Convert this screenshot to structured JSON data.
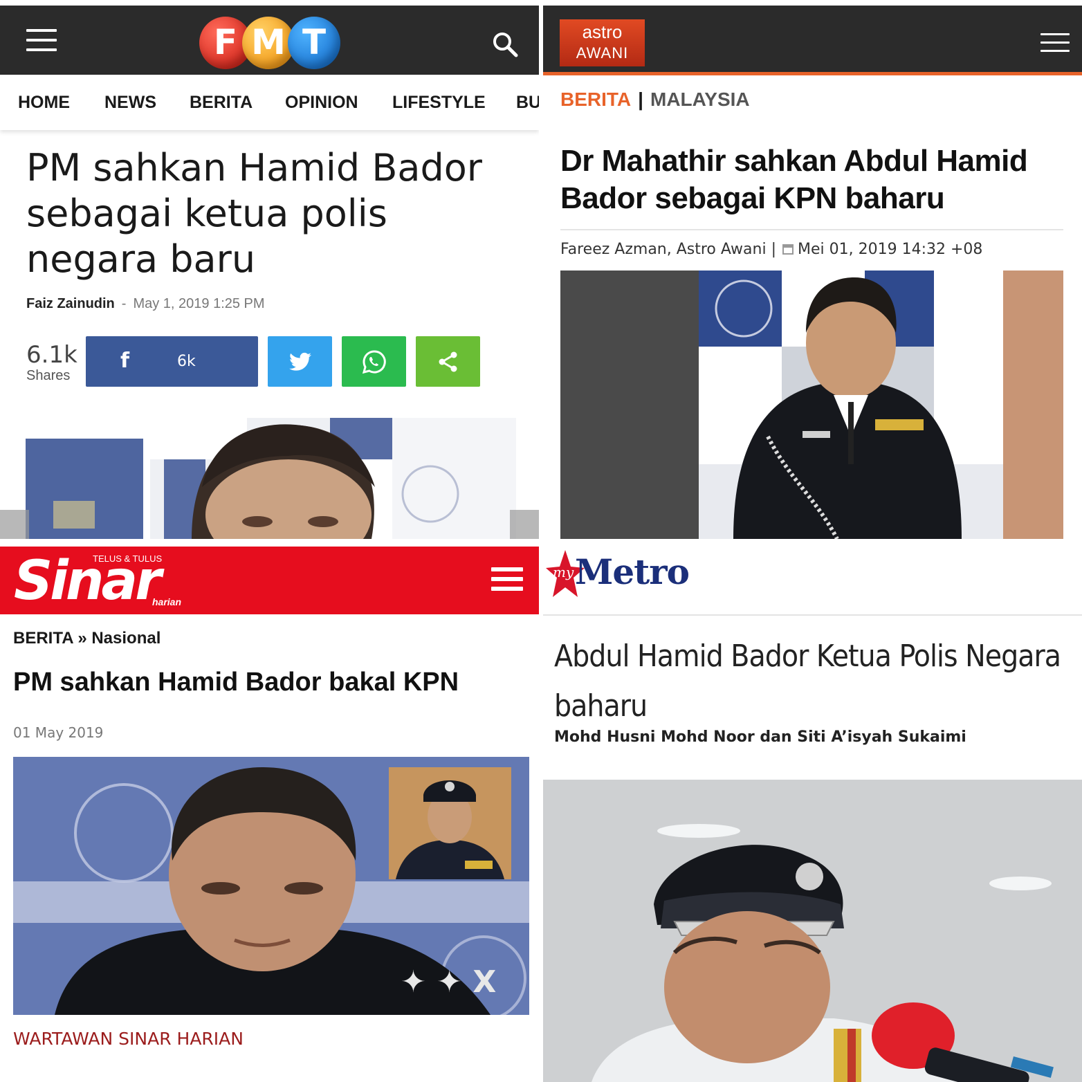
{
  "fmt": {
    "logo_letters": [
      "F",
      "M",
      "T"
    ],
    "nav": [
      "HOME",
      "NEWS",
      "BERITA",
      "OPINION",
      "LIFESTYLE",
      "BU"
    ],
    "title": "PM sahkan Hamid Bador sebagai ketua polis negara baru",
    "author": "Faiz Zainudin",
    "byline_sep": "-",
    "date": "May 1, 2019 1:25 PM",
    "shares_count": "6.1k",
    "shares_label": "Shares",
    "facebook_count": "6k",
    "colors": {
      "header": "#2b2b2b",
      "facebook": "#3b5998",
      "twitter": "#34a3ed",
      "whatsapp": "#2bbb4f",
      "share": "#6abe35"
    },
    "icons": [
      "menu-icon",
      "search-icon",
      "facebook-icon",
      "twitter-icon",
      "whatsapp-icon",
      "share-icon"
    ]
  },
  "awani": {
    "logo_line1": "astro",
    "logo_line2": "AWANI",
    "crumb_section": "BERITA",
    "crumb_sep": "|",
    "crumb_sub": "MALAYSIA",
    "title": "Dr Mahathir sahkan Abdul Hamid Bador sebagai KPN baharu",
    "byline_author": "Fareez Azman, Astro Awani |",
    "byline_date": "Mei 01, 2019 14:32 +08",
    "colors": {
      "accent": "#e8632a",
      "header": "#2b2b2b"
    }
  },
  "sinar": {
    "logo_word": "Sinar",
    "logo_tagline": "TELUS & TULUS",
    "logo_sub": "harian",
    "crumb": "BERITA » Nasional",
    "title": "PM sahkan Hamid Bador bakal KPN",
    "date": "01 May 2019",
    "author": "WARTAWAN SINAR HARIAN",
    "colors": {
      "header": "#e60d1e",
      "author": "#9b1c1c"
    }
  },
  "metro": {
    "logo_prefix": "my",
    "logo_word": "Metro",
    "title": "Abdul Hamid Bador Ketua Polis Negara baharu",
    "authors": "Mohd Husni Mohd Noor dan Siti A’isyah Sukaimi",
    "colors": {
      "logo_blue": "#1b2f7a",
      "logo_red": "#d8152a"
    }
  }
}
